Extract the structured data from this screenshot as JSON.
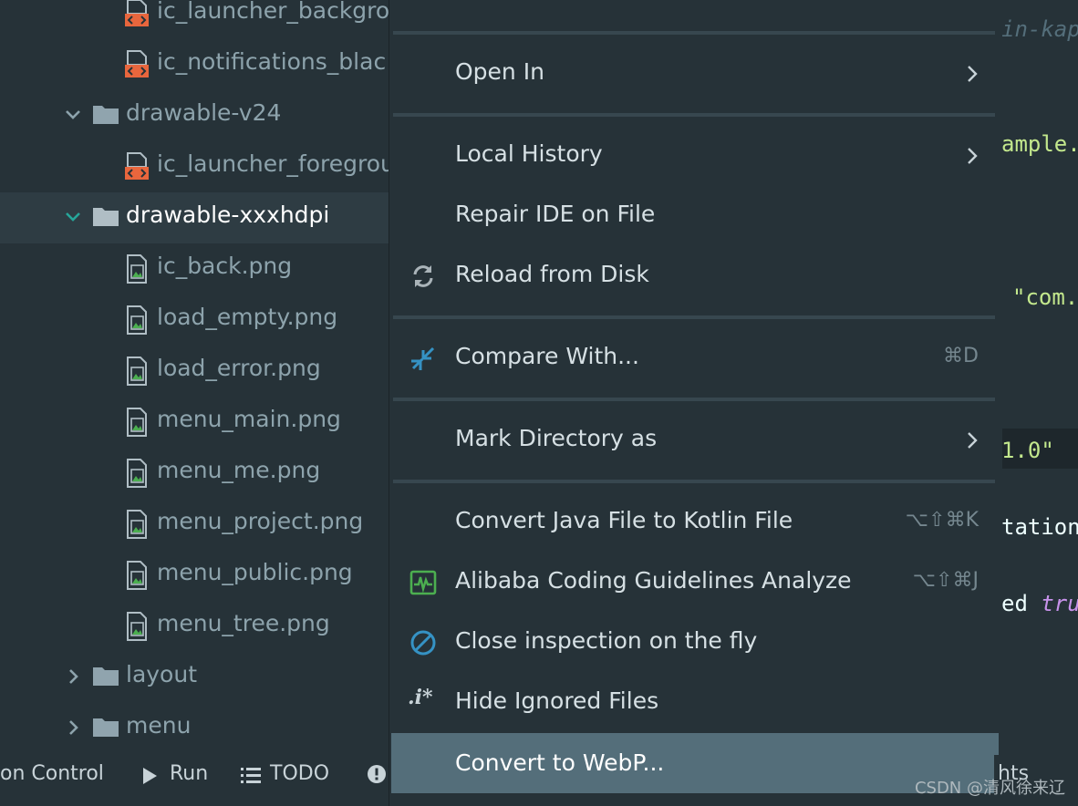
{
  "tree": {
    "items": [
      {
        "label": "ic_launcher_backgro",
        "kind": "xml"
      },
      {
        "label": "ic_notifications_blac",
        "kind": "xml"
      },
      {
        "label": "drawable-v24",
        "kind": "folder",
        "expanded": true
      },
      {
        "label": "ic_launcher_foregrou",
        "kind": "xml"
      },
      {
        "label": "drawable-xxxhdpi",
        "kind": "folder",
        "expanded": true,
        "selected": true
      },
      {
        "label": "ic_back.png",
        "kind": "image"
      },
      {
        "label": "load_empty.png",
        "kind": "image"
      },
      {
        "label": "load_error.png",
        "kind": "image"
      },
      {
        "label": "menu_main.png",
        "kind": "image"
      },
      {
        "label": "menu_me.png",
        "kind": "image"
      },
      {
        "label": "menu_project.png",
        "kind": "image"
      },
      {
        "label": "menu_public.png",
        "kind": "image"
      },
      {
        "label": "menu_tree.png",
        "kind": "image"
      },
      {
        "label": "layout",
        "kind": "folder",
        "expanded": false
      },
      {
        "label": "menu",
        "kind": "folder",
        "expanded": false
      }
    ]
  },
  "menu": {
    "items": [
      {
        "label": "Open In",
        "submenu": true
      },
      {
        "label": "Local History",
        "submenu": true
      },
      {
        "label": "Repair IDE on File"
      },
      {
        "label": "Reload from Disk",
        "icon": "reload-icon"
      },
      {
        "label": "Compare With...",
        "icon": "compare-icon",
        "shortcut": "⌘D"
      },
      {
        "label": "Mark Directory as",
        "submenu": true
      },
      {
        "label": "Convert Java File to Kotlin File",
        "shortcut": "⌥⇧⌘K"
      },
      {
        "label": "Alibaba Coding Guidelines Analyze",
        "icon": "analyze-icon",
        "shortcut": "⌥⇧⌘J"
      },
      {
        "label": "Close inspection on the fly",
        "icon": "prohibited-icon"
      },
      {
        "label": "Hide Ignored Files",
        "icon": "ignored-files-icon",
        "icon_text": ".i*"
      },
      {
        "label": "Convert to WebP...",
        "active": true
      }
    ]
  },
  "editor": {
    "lines": [
      {
        "text": "in-kap",
        "color": "#546e7a",
        "italic": true
      },
      {
        "text": "ample.c",
        "color": "#c3e88d"
      },
      {
        "text": "\"com.e",
        "color": "#c3e88d"
      },
      {
        "text": "1.0\"",
        "color": "#c3e88d"
      },
      {
        "text": "tationR",
        "color": "#eeffff"
      },
      {
        "text": "ed",
        "color": "#eeffff"
      },
      {
        "text": "tru",
        "color": "#c792ea",
        "italic": true
      }
    ]
  },
  "toolbar": {
    "version_control": "on Control",
    "run": "Run",
    "todo": "TODO",
    "right_label": "hts"
  },
  "watermark": "CSDN @清风徐来辽",
  "colors": {
    "accent": "#546e7a",
    "tree_text": "#8da3ac",
    "folder": "#90a4ae",
    "xml_icon": "#e8663d",
    "image_icon": "#4caf50",
    "menu_text": "#d6e0e4"
  }
}
